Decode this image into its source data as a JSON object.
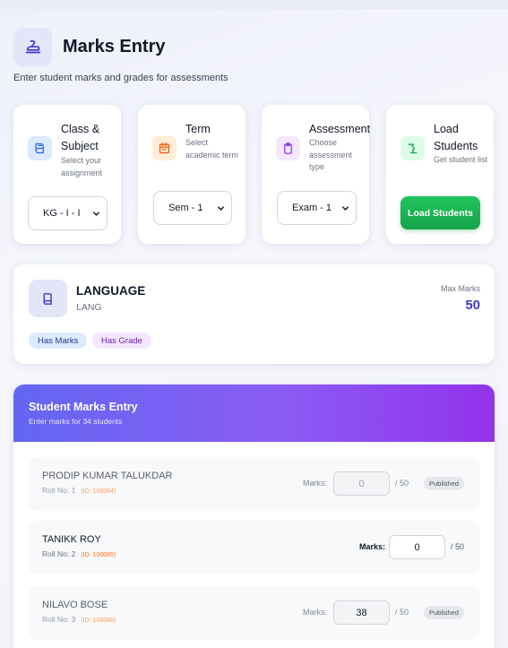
{
  "page": {
    "title": "Marks Entry",
    "subtitle": "Enter student marks and grades for assessments"
  },
  "steps": [
    {
      "title": "Class & Subject",
      "desc": "Select your assignment",
      "value": "KG - I - I",
      "icon": "book-icon",
      "color": "#2563eb"
    },
    {
      "title": "Term",
      "desc": "Select academic term",
      "value": "Sem - 1",
      "icon": "calendar-icon",
      "color": "#ea580c"
    },
    {
      "title": "Assessment",
      "desc": "Choose assessment type",
      "value": "Exam - 1",
      "icon": "clipboard-icon",
      "color": "#9333ea"
    },
    {
      "title": "Load Students",
      "desc": "Get student list",
      "button": "Load Students",
      "icon": "lamp-icon",
      "color": "#16a34a"
    }
  ],
  "subject": {
    "name": "LANGUAGE",
    "code": "LANG",
    "max_label": "Max Marks",
    "max_value": "50",
    "chips": [
      "Has Marks",
      "Has Grade"
    ]
  },
  "entry": {
    "title": "Student Marks Entry",
    "subtitle": "Enter marks for 34 students",
    "marks_label": "Marks:",
    "out_of": "/ 50",
    "students": [
      {
        "name": "PRODIP KUMAR TALUKDAR",
        "roll": "Roll No: 1",
        "id": "(ID: 100084)",
        "marks": "",
        "placeholder": "0",
        "status": "Published"
      },
      {
        "name": "TANIKK ROY",
        "roll": "Roll No: 2",
        "id": "(ID: 100085)",
        "marks": "",
        "placeholder": "0",
        "status": ""
      },
      {
        "name": "NILAVO BOSE",
        "roll": "Roll No: 3",
        "id": "(ID: 100086)",
        "marks": "38",
        "placeholder": "0",
        "status": "Published"
      }
    ]
  }
}
